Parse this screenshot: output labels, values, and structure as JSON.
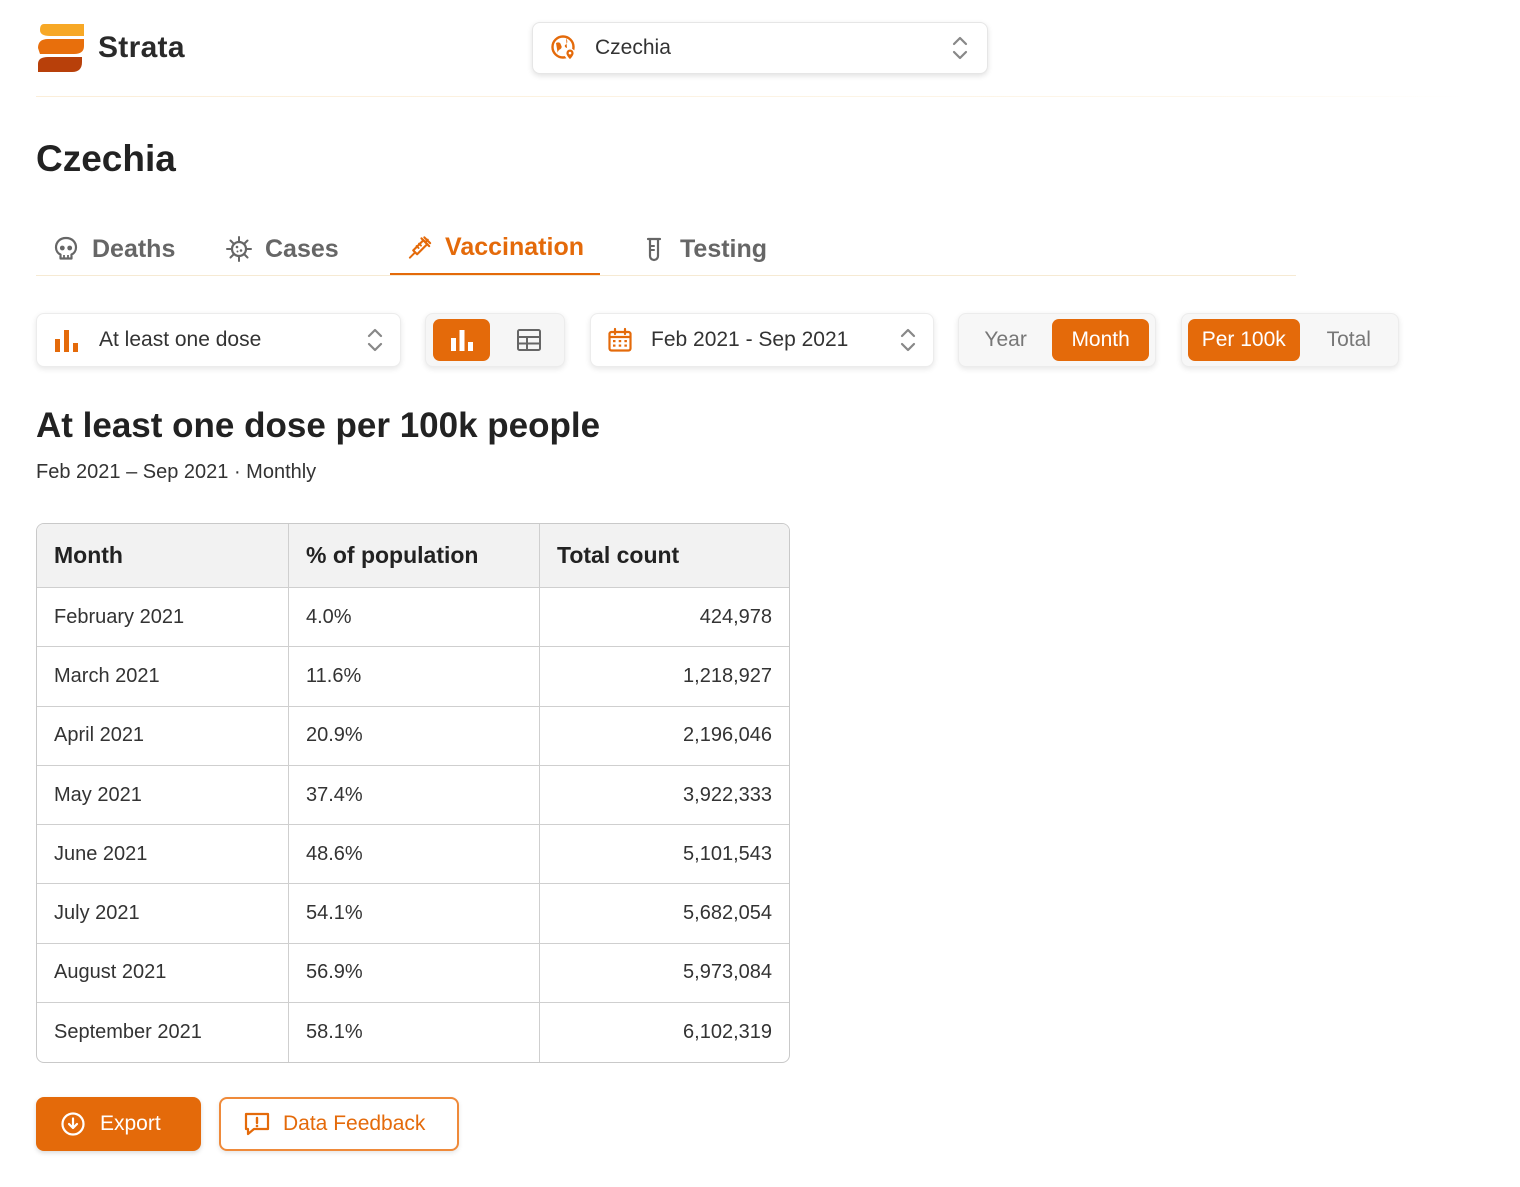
{
  "app": {
    "name": "Strata"
  },
  "country_select": {
    "value": "Czechia"
  },
  "page": {
    "title": "Czechia"
  },
  "tabs": [
    {
      "label": "Deaths",
      "icon": "skull-icon",
      "active": false
    },
    {
      "label": "Cases",
      "icon": "virus-icon",
      "active": false
    },
    {
      "label": "Vaccination",
      "icon": "syringe-icon",
      "active": true
    },
    {
      "label": "Testing",
      "icon": "test-tube-icon",
      "active": false
    }
  ],
  "controls": {
    "metric": "At least one dose",
    "view": "chart",
    "date_range": "Feb 2021 - Sep 2021",
    "granularity": {
      "options": [
        "Year",
        "Month"
      ],
      "selected": "Month"
    },
    "mode": {
      "options": [
        "Per 100k",
        "Total"
      ],
      "selected": "Per 100k"
    }
  },
  "chart": {
    "title": "At least one dose per 100k people",
    "subtitle": "Feb 2021 – Sep 2021 · Monthly"
  },
  "table": {
    "headers": [
      "Month",
      "% of population",
      "Total count"
    ],
    "rows": [
      [
        "February 2021",
        "4.0%",
        "424,978"
      ],
      [
        "March 2021",
        "11.6%",
        "1,218,927"
      ],
      [
        "April 2021",
        "20.9%",
        "2,196,046"
      ],
      [
        "May 2021",
        "37.4%",
        "3,922,333"
      ],
      [
        "June 2021",
        "48.6%",
        "5,101,543"
      ],
      [
        "July 2021",
        "54.1%",
        "5,682,054"
      ],
      [
        "August 2021",
        "56.9%",
        "5,973,084"
      ],
      [
        "September 2021",
        "58.1%",
        "6,102,319"
      ]
    ]
  },
  "actions": {
    "export": "Export",
    "feedback": "Data Feedback"
  },
  "colors": {
    "accent": "#e46a0a",
    "accent_light": "#f5a623",
    "text": "#222222"
  }
}
